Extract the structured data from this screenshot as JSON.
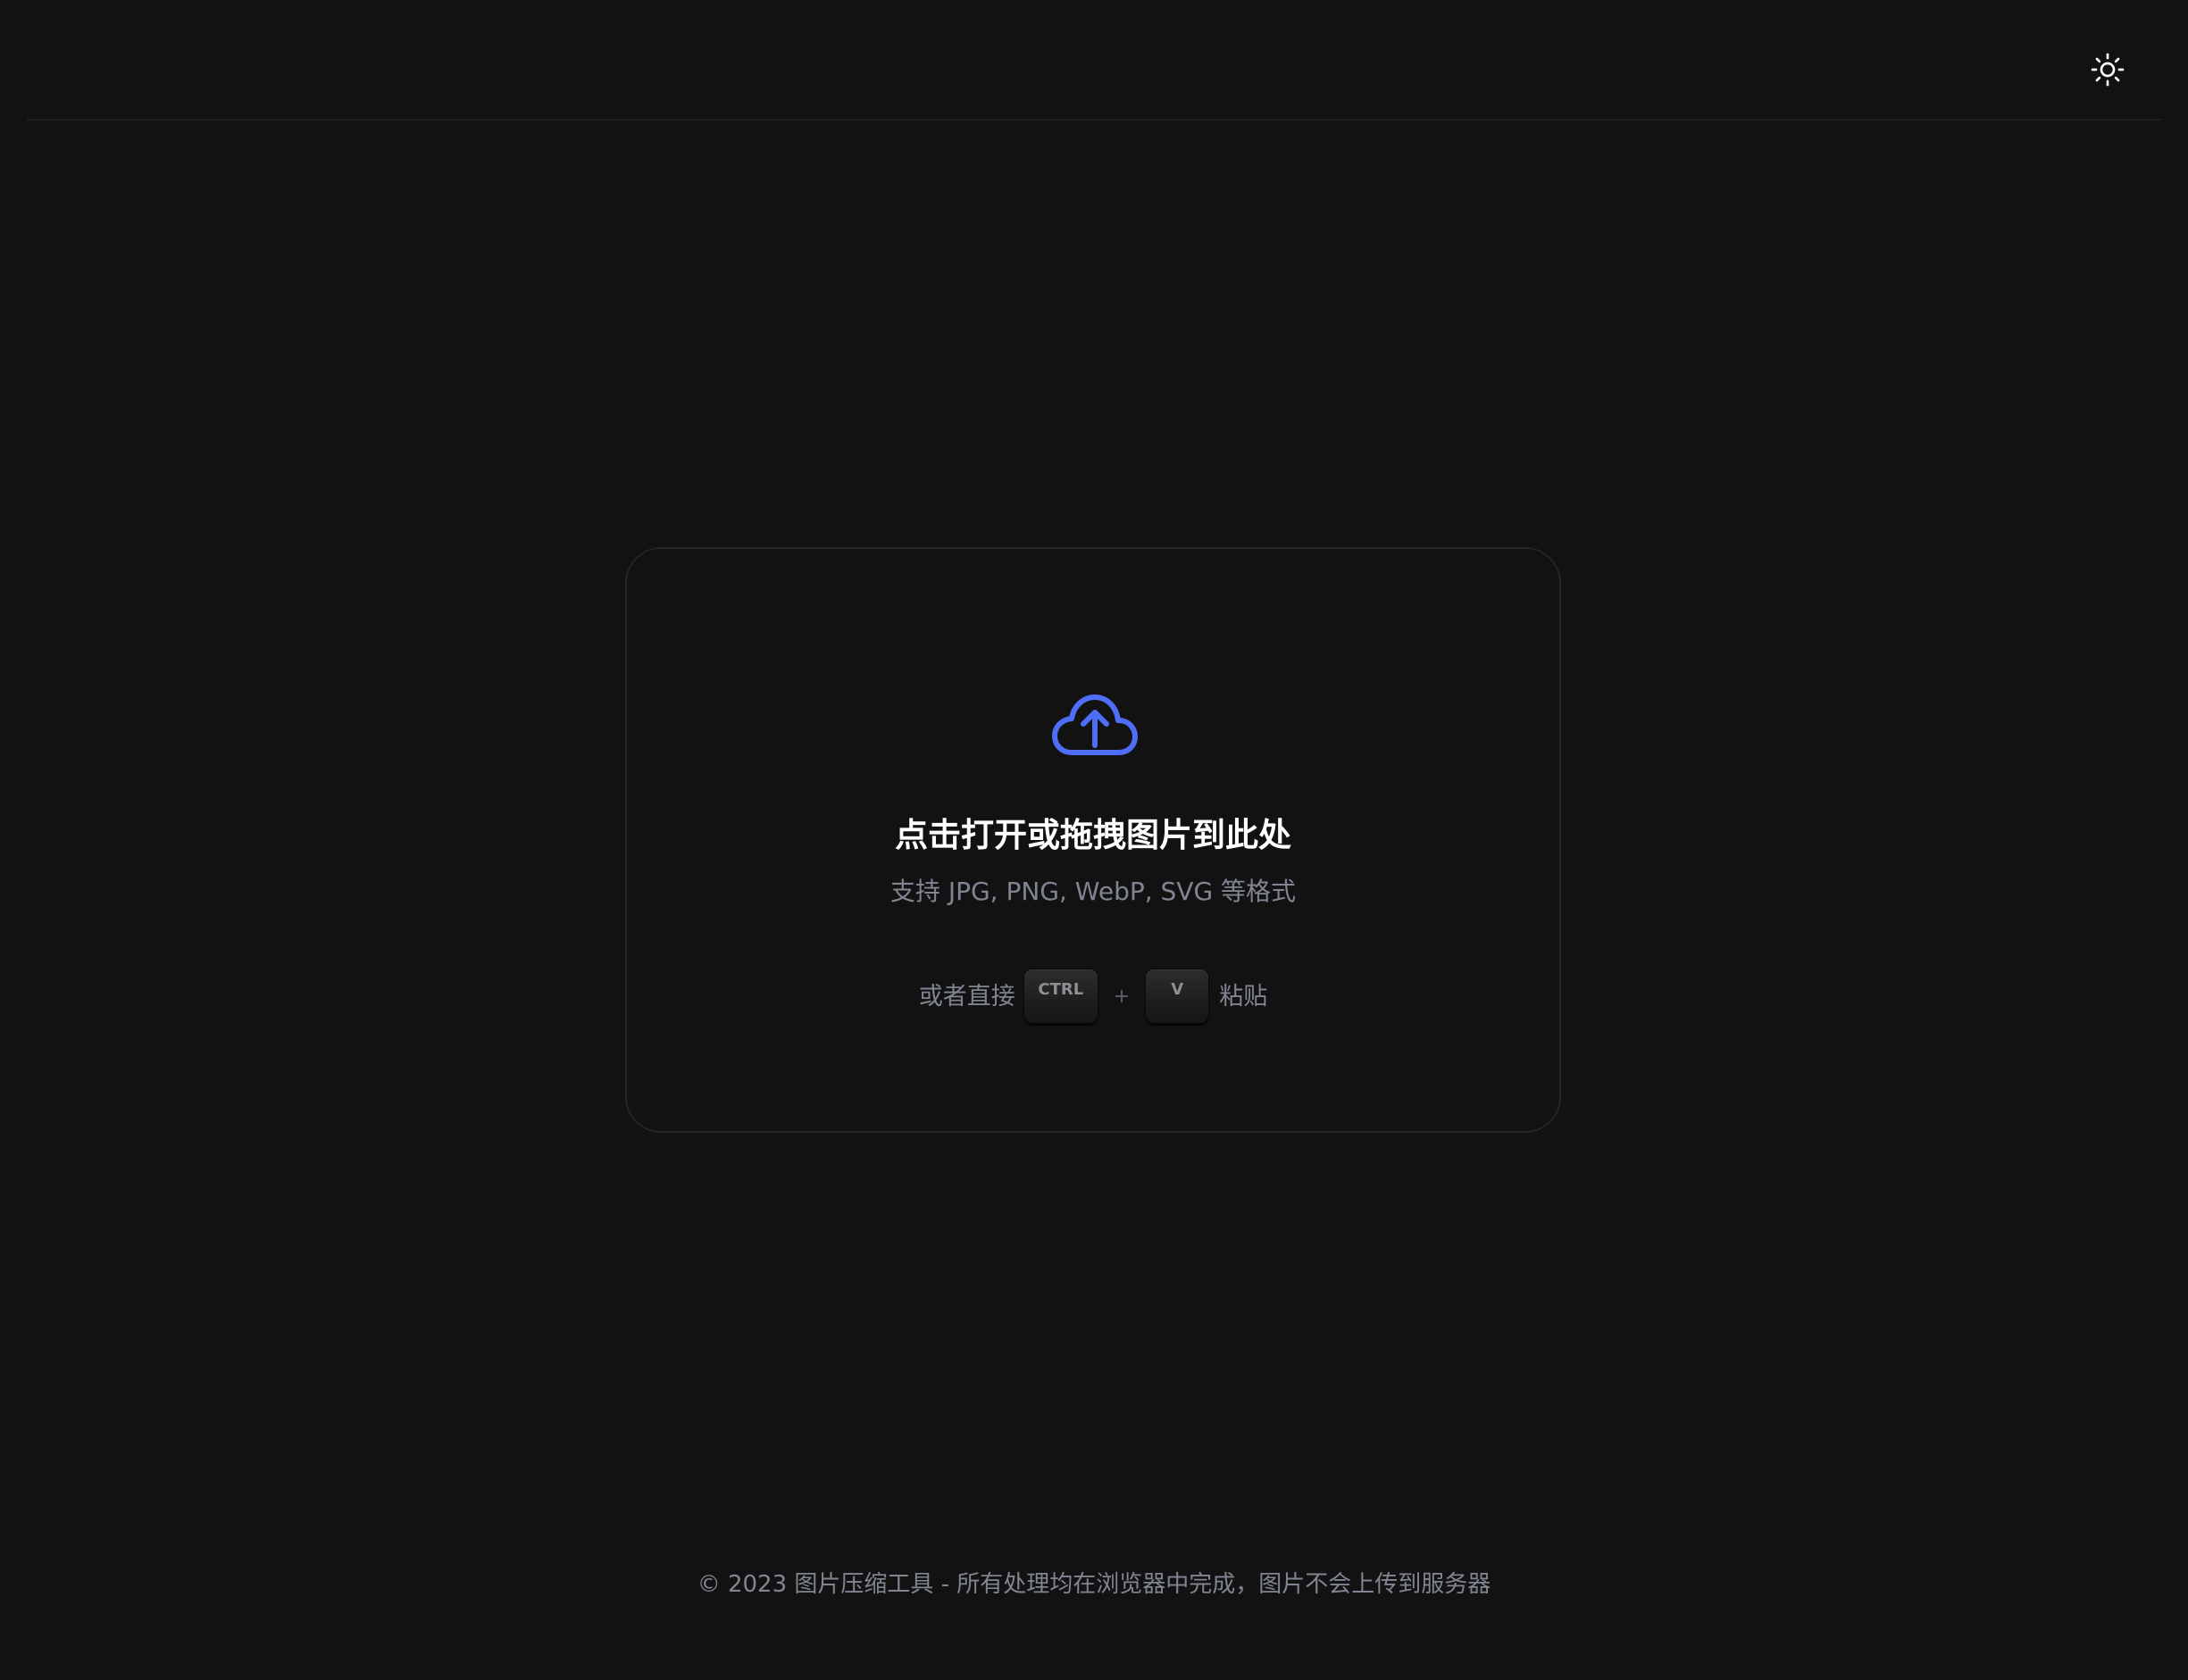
{
  "header": {
    "theme_toggle_icon": "sun-icon"
  },
  "dropzone": {
    "icon": "cloud-upload-icon",
    "accent_color": "#4f6ef7",
    "title": "点击打开或拖拽图片到此处",
    "subtitle": "支持 JPG, PNG, WebP, SVG 等格式",
    "paste_prefix": "或者直接",
    "key_ctrl": "CTRL",
    "key_plus": "+",
    "key_v": "V",
    "paste_suffix": "粘贴"
  },
  "footer": {
    "text": "© 2023 图片压缩工具 - 所有处理均在浏览器中完成，图片不会上传到服务器"
  }
}
